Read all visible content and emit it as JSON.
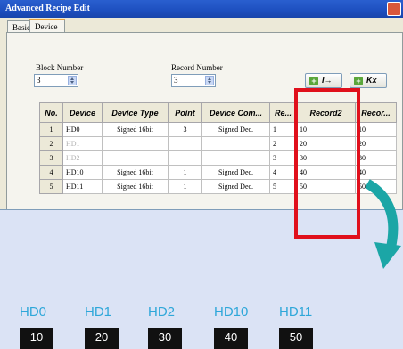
{
  "window": {
    "title": "Advanced Recipe Edit",
    "tabs": [
      "Basic",
      "Device"
    ]
  },
  "form": {
    "block_number_label": "Block Number",
    "block_number_value": "3",
    "record_number_label": "Record Number",
    "record_number_value": "3",
    "btn_add_row": "I→",
    "btn_add_col": "Kx"
  },
  "table": {
    "headers": [
      "No.",
      "Device",
      "Device Type",
      "Point",
      "Device Com...",
      "Re...",
      "Record2",
      "Recor..."
    ],
    "rows": [
      {
        "no": "1",
        "device": "HD0",
        "type": "Signed 16bit",
        "point": "3",
        "comment": "Signed Dec.",
        "re": "1",
        "record2": "10",
        "recor": "10"
      },
      {
        "no": "2",
        "device": "HD1",
        "type": "",
        "point": "",
        "comment": "",
        "re": "2",
        "record2": "20",
        "recor": "20"
      },
      {
        "no": "3",
        "device": "HD2",
        "type": "",
        "point": "",
        "comment": "",
        "re": "3",
        "record2": "30",
        "recor": "30"
      },
      {
        "no": "4",
        "device": "HD10",
        "type": "Signed 16bit",
        "point": "1",
        "comment": "Signed Dec.",
        "re": "4",
        "record2": "40",
        "recor": "40"
      },
      {
        "no": "5",
        "device": "HD11",
        "type": "Signed 16bit",
        "point": "1",
        "comment": "Signed Dec.",
        "re": "5",
        "record2": "50",
        "recor": "50"
      }
    ]
  },
  "registers": [
    {
      "name": "HD0",
      "value": "10"
    },
    {
      "name": "HD1",
      "value": "20"
    },
    {
      "name": "HD2",
      "value": "30"
    },
    {
      "name": "HD10",
      "value": "40"
    },
    {
      "name": "HD11",
      "value": "50"
    }
  ],
  "colors": {
    "highlight": "#e0101c",
    "arrow": "#1ba6a6",
    "register_label": "#2ea7d9"
  }
}
